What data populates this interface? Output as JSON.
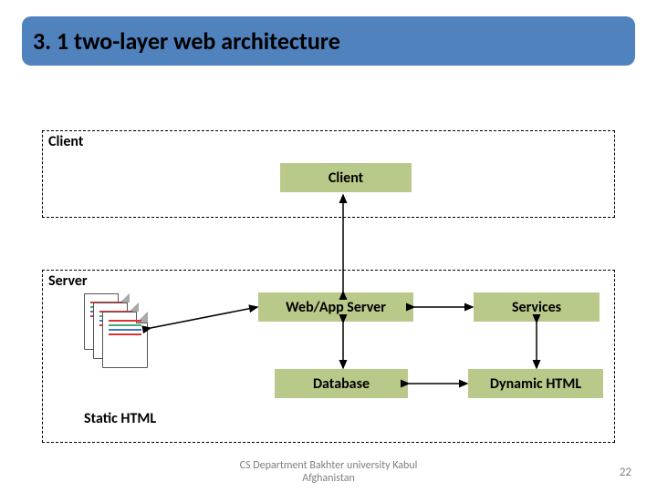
{
  "title": "3. 1 two-layer web architecture",
  "panels": {
    "client_label": "Client",
    "server_label": "Server"
  },
  "nodes": {
    "client": "Client",
    "webapp": "Web/App Server",
    "services": "Services",
    "database": "Database",
    "dynamic": "Dynamic HTML"
  },
  "static_html_label": "Static HTML",
  "footer_line1": "CS Department Bakhter university Kabul",
  "footer_line2": "Afghanistan",
  "page_number": "22"
}
